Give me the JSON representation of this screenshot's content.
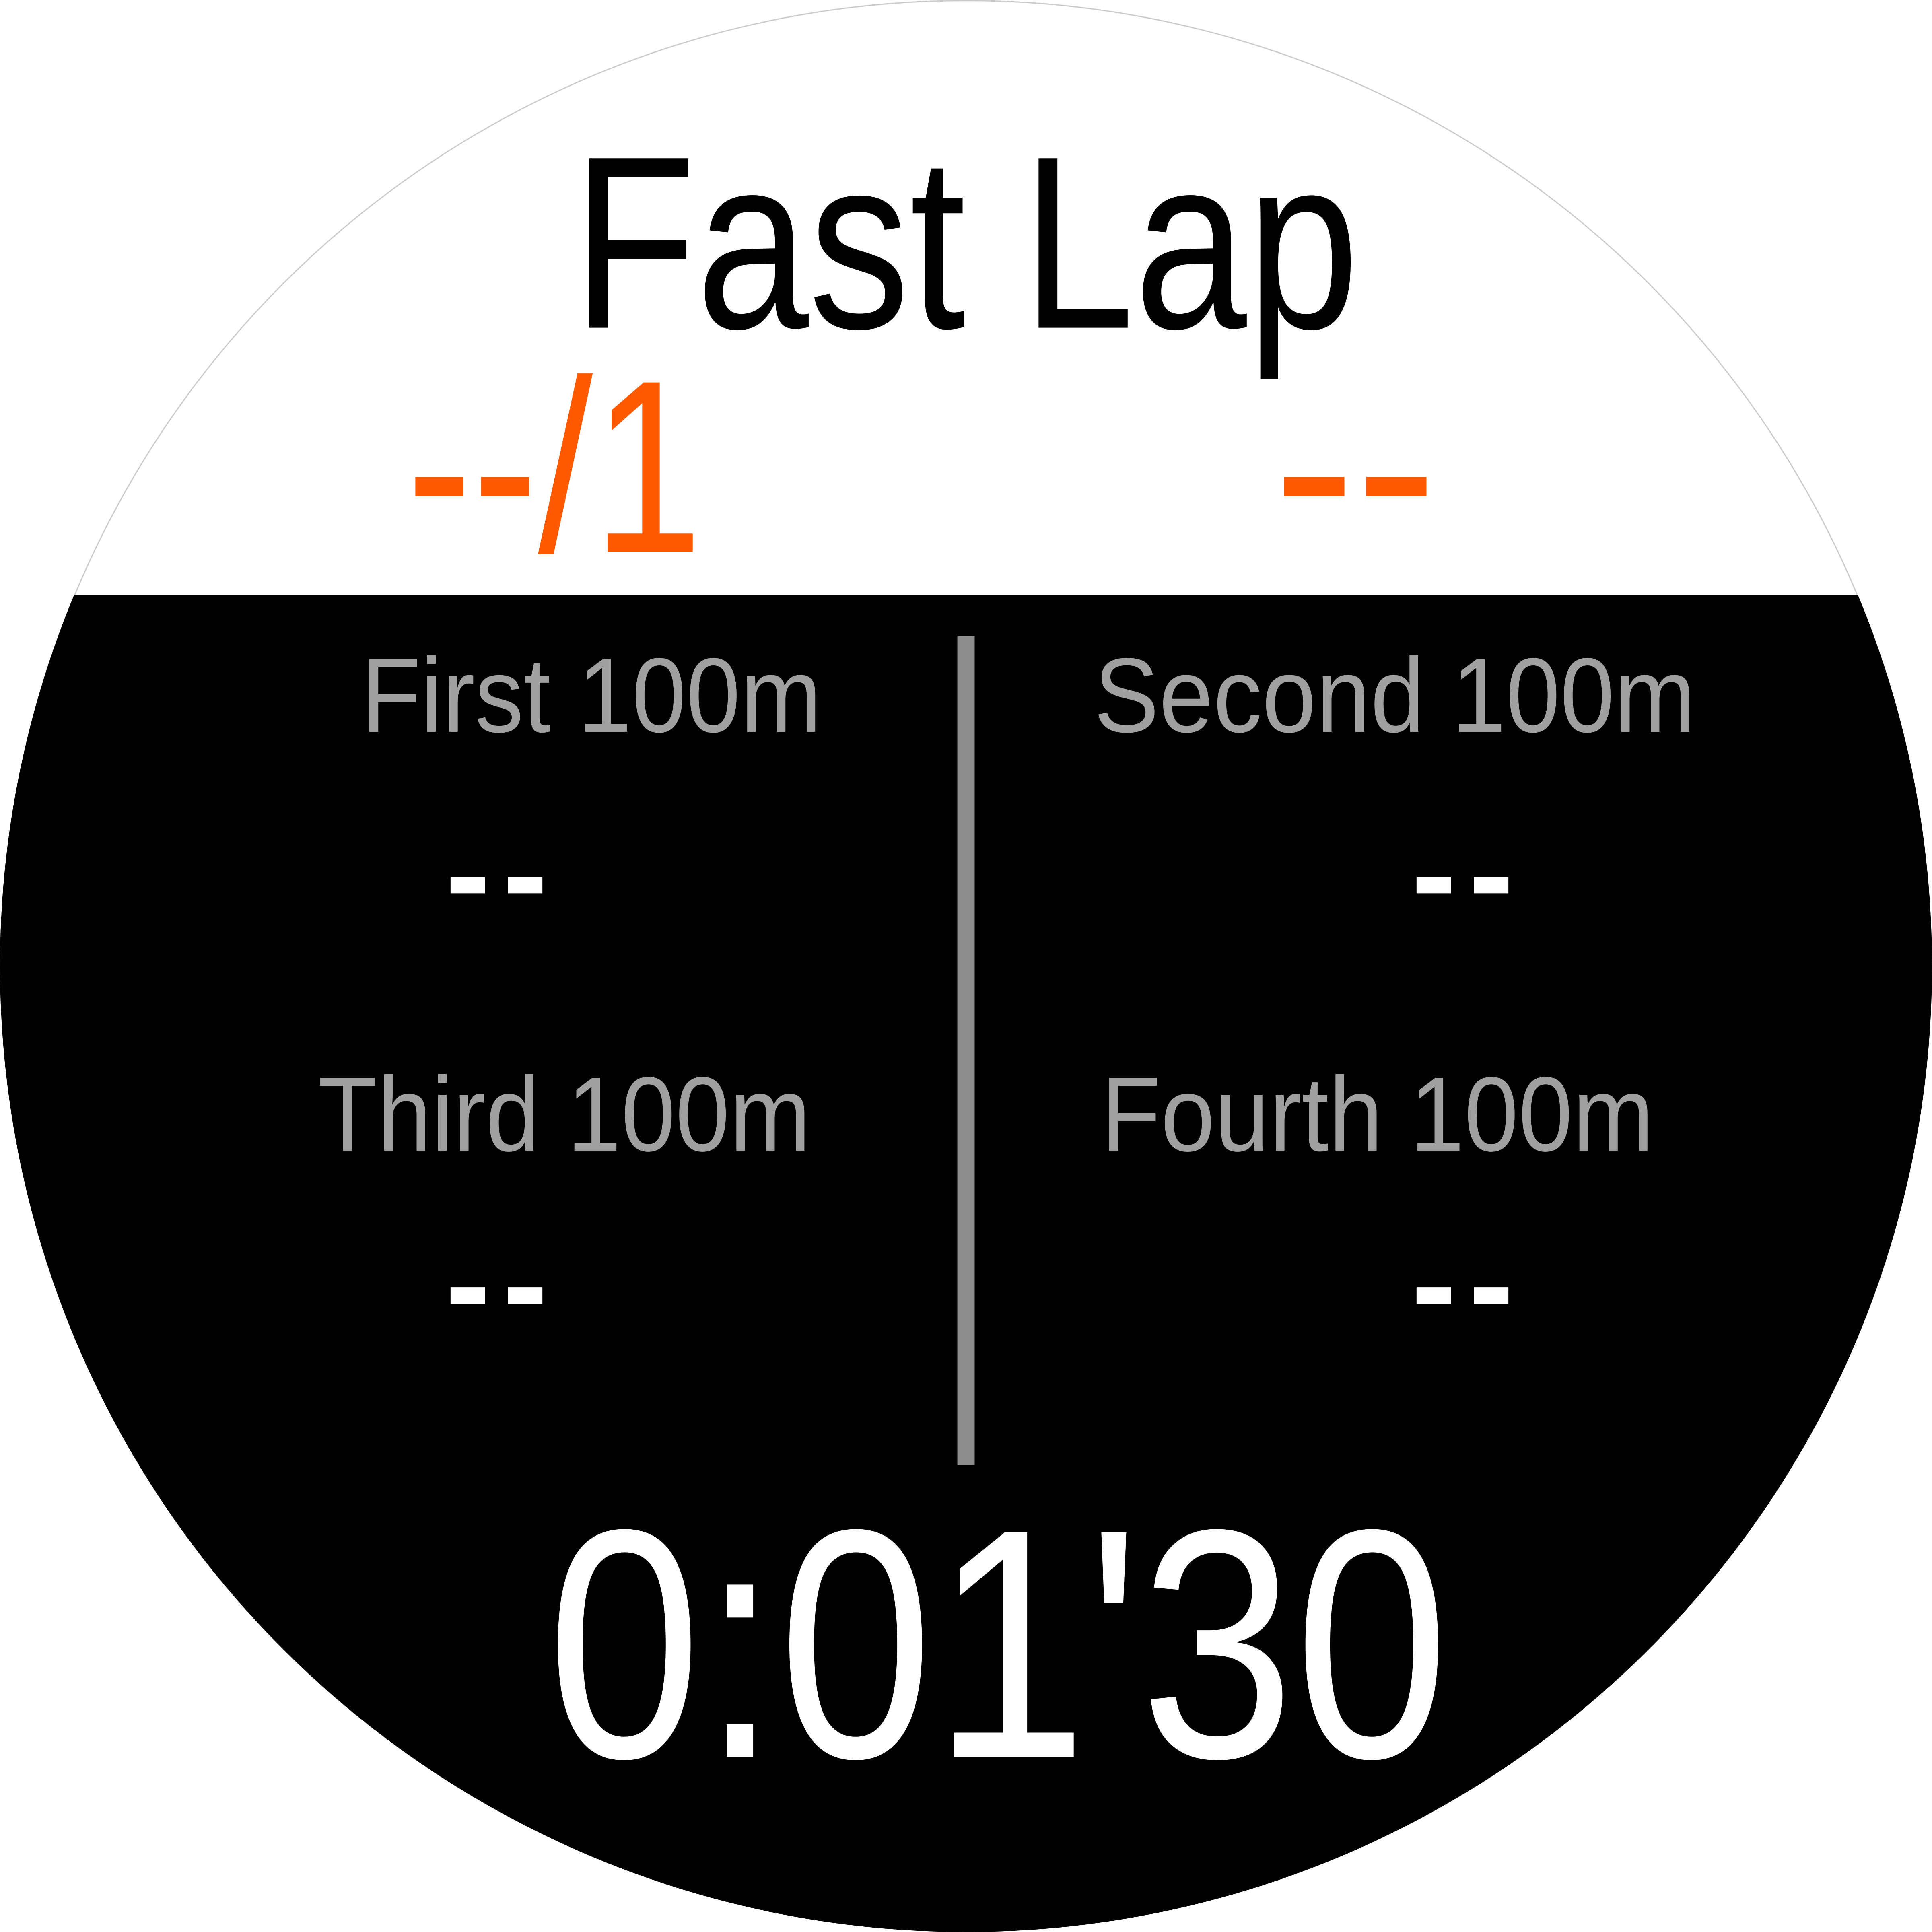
{
  "title": "Fast Lap",
  "lap_indicator": "--/1",
  "lap_right_value": "--",
  "cells": [
    {
      "label": "First 100m",
      "value": "--"
    },
    {
      "label": "Second 100m",
      "value": "--"
    },
    {
      "label": "Third 100m",
      "value": "--"
    },
    {
      "label": "Fourth 100m",
      "value": "--"
    }
  ],
  "elapsed_time": "0:01'30",
  "colors": {
    "accent": "#ff5a00",
    "label": "#a0a0a0",
    "divider": "#8c8c8c"
  }
}
